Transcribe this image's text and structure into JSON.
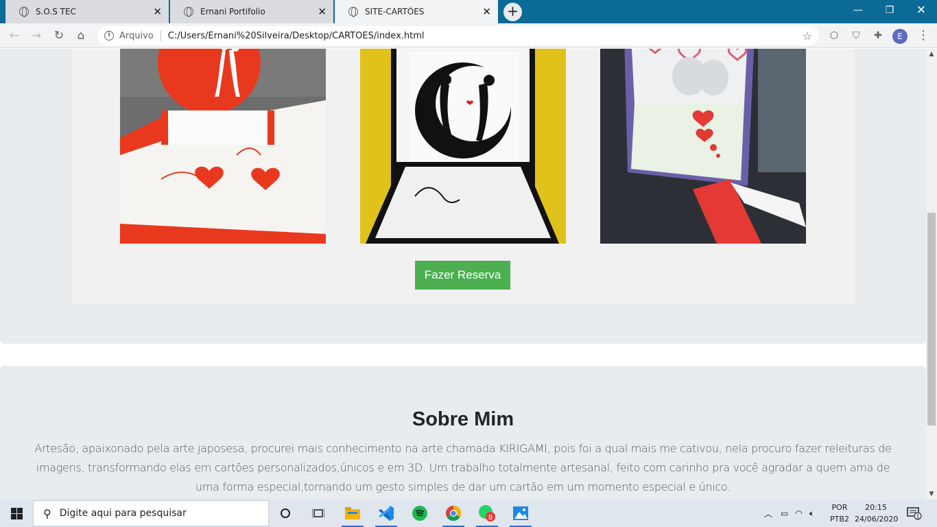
{
  "browser": {
    "tabs": [
      {
        "label": "S.O.S TEC",
        "active": false
      },
      {
        "label": "Ernani Portifolio",
        "active": false
      },
      {
        "label": "SITE-CARTÕES",
        "active": true
      }
    ],
    "address": {
      "scheme_label": "Arquivo",
      "url": "C:/Users/Ernani%20Silveira/Desktop/CARTOES/index.html"
    },
    "profile_initial": "E"
  },
  "gallery": {
    "images": [
      {
        "name": "red-heart-couple-card"
      },
      {
        "name": "moon-couple-card"
      },
      {
        "name": "purple-hearts-card"
      }
    ],
    "reserve_button": "Fazer Reserva"
  },
  "about": {
    "title": "Sobre Mim",
    "text": "Artesão, apaixonado pela arte japosesa, procurei mais conhecimento na arte chamada KIRIGAMI, pois foi a qual mais me cativou, nela procuro fazer releituras de imagens, transformando elas em cartões personalizados,únicos e em 3D. Um trabalho totalmente artesanal, feito com carinho pra você agradar a quem ama de uma forma especial,tornando um gesto simples de dar um cartão em um momento especial e único."
  },
  "taskbar": {
    "search_placeholder": "Digite aqui para pesquisar",
    "whatsapp_badge": "8",
    "language": [
      "POR",
      "PTB2"
    ],
    "time": "20:15",
    "date": "24/06/2020",
    "notification_count": "1"
  },
  "colors": {
    "accent_green": "#4caf50",
    "tabstrip_blue": "#0b6a96",
    "section_bg": "#e9ecef"
  }
}
